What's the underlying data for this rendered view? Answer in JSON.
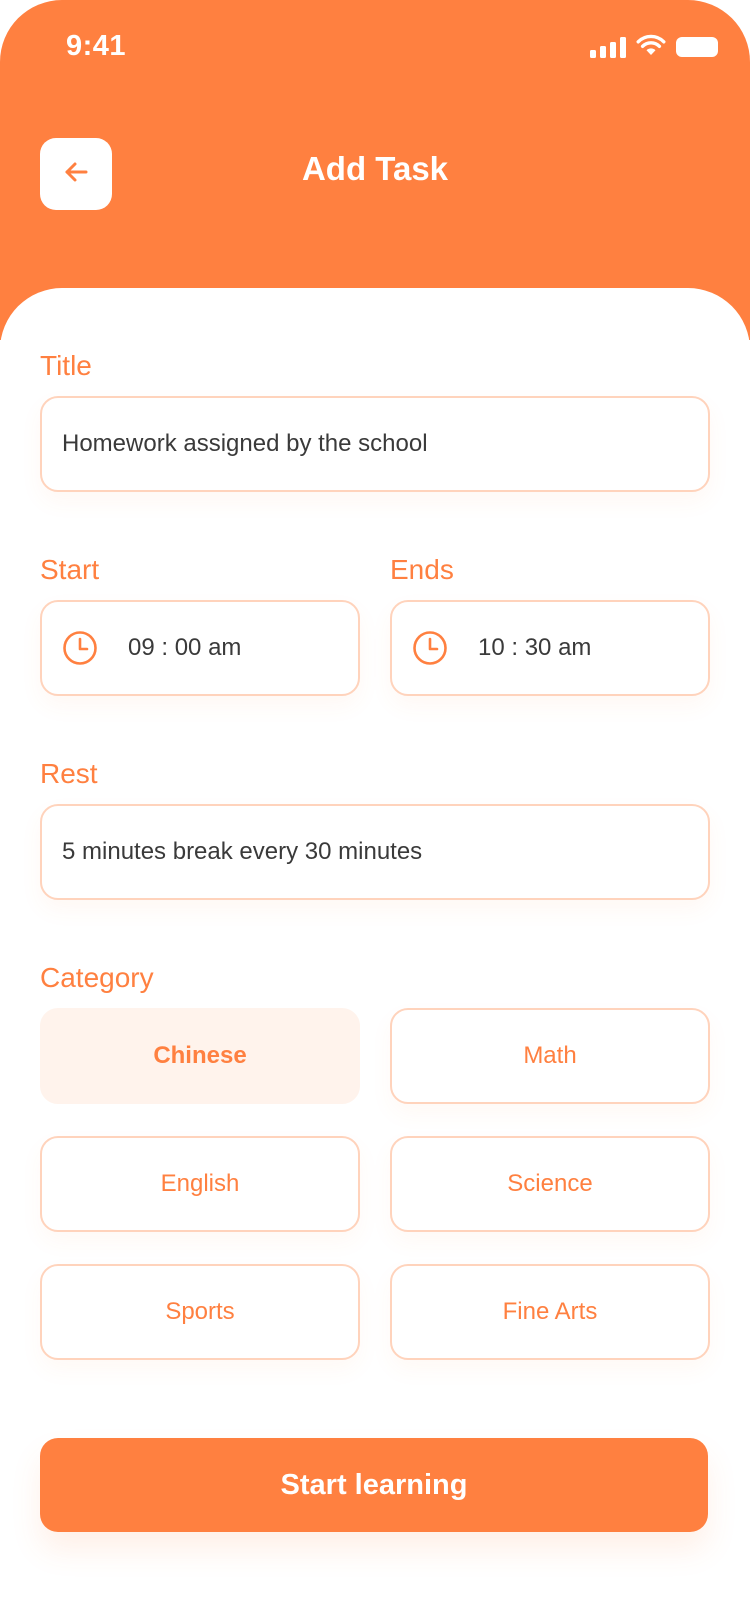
{
  "status_bar": {
    "time": "9:41"
  },
  "header": {
    "title": "Add Task"
  },
  "form": {
    "title_label": "Title",
    "title_value": "Homework assigned by the school",
    "start_label": "Start",
    "start_value": "09 : 00 am",
    "ends_label": "Ends",
    "ends_value": "10 : 30 am",
    "rest_label": "Rest",
    "rest_value": "5 minutes break every 30 minutes",
    "category_label": "Category",
    "categories": [
      "Chinese",
      "Math",
      "English",
      "Science",
      "Sports",
      "Fine Arts"
    ],
    "selected_category": "Chinese"
  },
  "cta": {
    "label": "Start learning"
  },
  "colors": {
    "accent": "#FF8040",
    "field_border": "#FFD3BC",
    "selected_chip_bg": "#FFF3EC"
  }
}
